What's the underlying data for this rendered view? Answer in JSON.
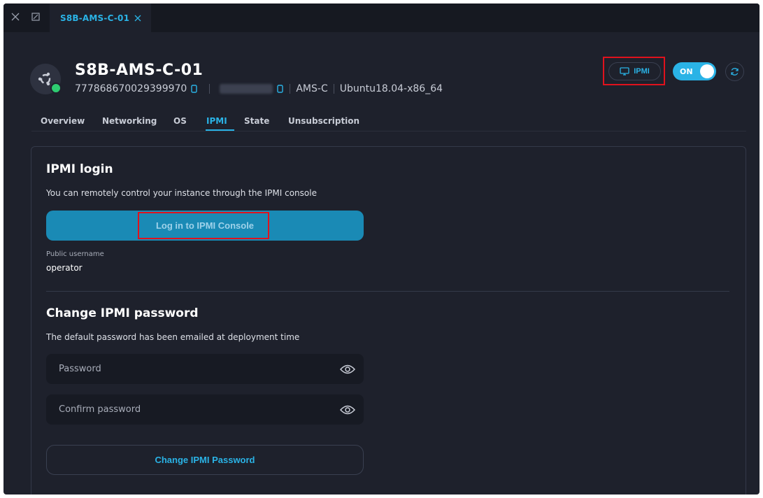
{
  "tabbar": {
    "active_tab_label": "S8B-AMS-C-01"
  },
  "header": {
    "title": "S8B-AMS-C-01",
    "id": "777868670029399970",
    "region": "AMS-C",
    "os": "Ubuntu18.04-x86_64",
    "ipmi_button_label": "IPMI",
    "power_toggle_label": "ON",
    "power_on": true
  },
  "subnav": {
    "tabs": [
      "Overview",
      "Networking",
      "OS",
      "IPMI",
      "State",
      "Unsubscription"
    ],
    "active": "IPMI"
  },
  "ipmi_login": {
    "title": "IPMI login",
    "description": "You can remotely control your instance through the IPMI console",
    "button_label": "Log in to IPMI Console",
    "username_label": "Public username",
    "username_value": "operator"
  },
  "change_password": {
    "title": "Change IPMI password",
    "description": "The default password has been emailed at deployment time",
    "password_placeholder": "Password",
    "confirm_placeholder": "Confirm password",
    "button_label": "Change IPMI Password"
  },
  "colors": {
    "accent": "#2ab3e6",
    "background": "#1e212c",
    "highlight": "#e0121d",
    "status_online": "#2ecc71"
  },
  "icons": [
    "close-icon",
    "expand-icon",
    "tab-close-icon",
    "ubuntu-icon",
    "copy-icon",
    "monitor-icon",
    "refresh-icon",
    "eye-icon"
  ]
}
